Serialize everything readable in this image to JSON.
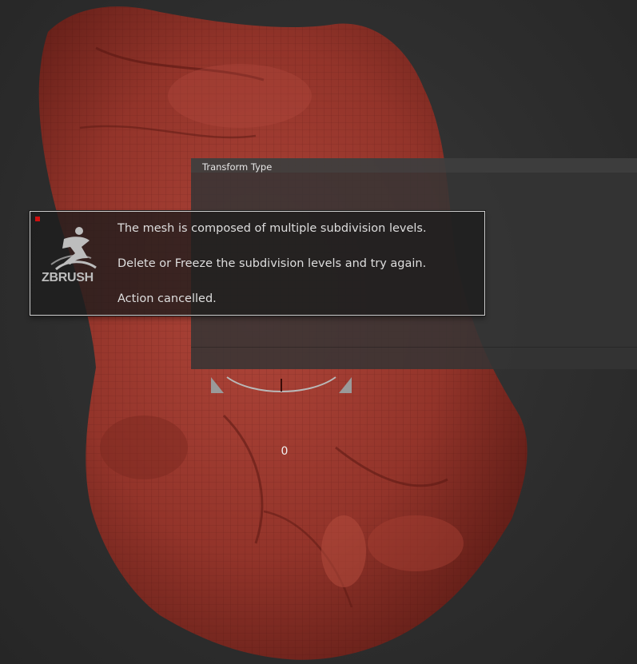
{
  "transform_panel": {
    "title": "Transform Type"
  },
  "gizmo": {
    "value": "0"
  },
  "dialog": {
    "logo_text": "ZBRUSH",
    "lines": [
      "The mesh is composed of multiple subdivision levels.",
      "Delete or Freeze the subdivision levels and try again.",
      "Action cancelled."
    ]
  },
  "colors": {
    "background": "#2e2e2e",
    "mesh": "#9a3328",
    "panel": "#343434",
    "dialog_border": "#cfcfcf",
    "alert_dot": "#d01010"
  },
  "icons": [
    "zbrush-logo-icon",
    "alert-dot-icon",
    "gizmo-dial-icon"
  ]
}
